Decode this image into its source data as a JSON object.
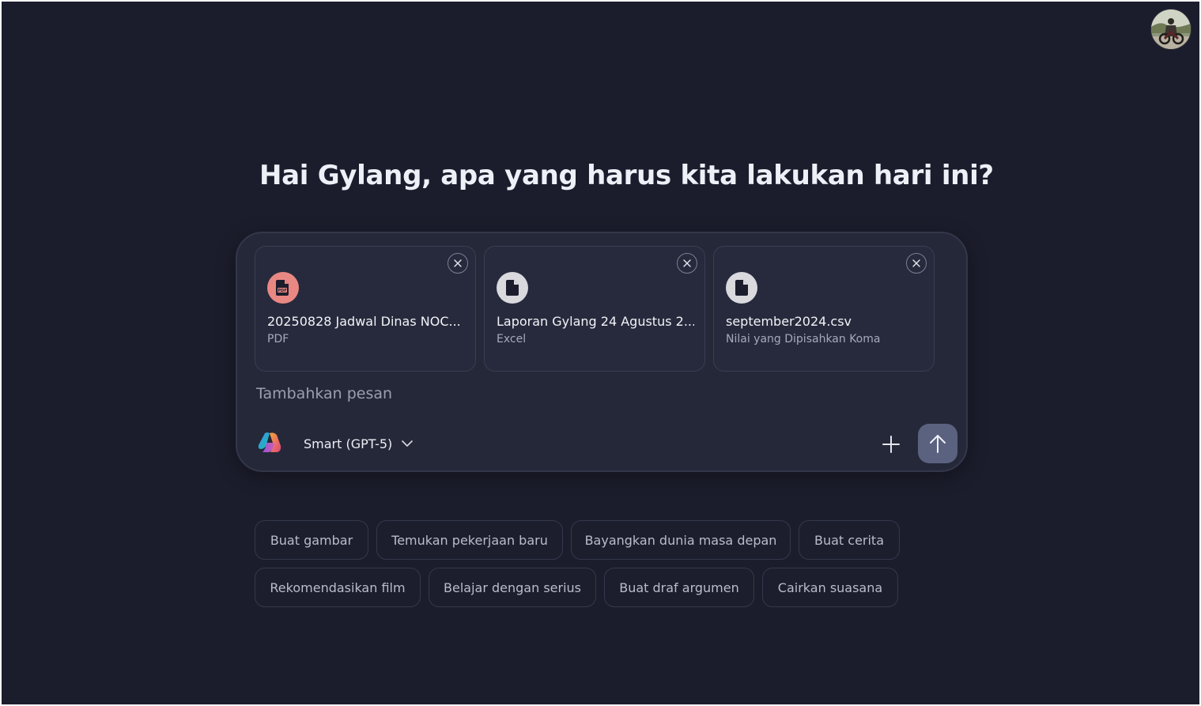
{
  "user": {
    "avatar_alt": "user-avatar"
  },
  "greeting": "Hai Gylang, apa yang harus kita lakukan hari ini?",
  "attachments": [
    {
      "name": "20250828 Jadwal Dinas NOC...",
      "type": "PDF",
      "icon": "pdf-file-icon",
      "icon_color": "#e98883"
    },
    {
      "name": "Laporan Gylang 24 Agustus 2...",
      "type": "Excel",
      "icon": "file-icon",
      "icon_color": "#d9d9de"
    },
    {
      "name": "september2024.csv",
      "type": "Nilai yang Dipisahkan Koma",
      "icon": "file-icon",
      "icon_color": "#d9d9de"
    }
  ],
  "composer": {
    "placeholder": "Tambahkan pesan",
    "model_label": "Smart (GPT-5)",
    "send_color": "#5b6280"
  },
  "suggestions": [
    [
      "Buat gambar",
      "Temukan pekerjaan baru",
      "Bayangkan dunia masa depan",
      "Buat cerita"
    ],
    [
      "Rekomendasikan film",
      "Belajar dengan serius",
      "Buat draf argumen",
      "Cairkan suasana"
    ]
  ],
  "colors": {
    "background": "#1c1d2c",
    "composer": "#252838",
    "card": "#262a3c",
    "text": "#eef0f8",
    "muted": "#a5a9bb"
  }
}
